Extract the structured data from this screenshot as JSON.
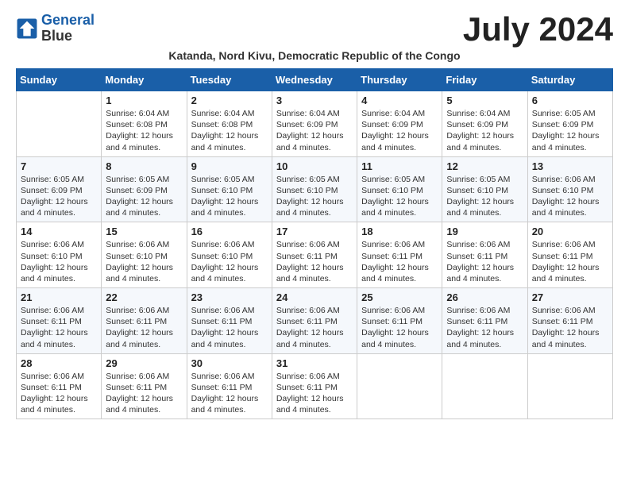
{
  "logo": {
    "line1": "General",
    "line2": "Blue"
  },
  "title": "July 2024",
  "subtitle": "Katanda, Nord Kivu, Democratic Republic of the Congo",
  "weekdays": [
    "Sunday",
    "Monday",
    "Tuesday",
    "Wednesday",
    "Thursday",
    "Friday",
    "Saturday"
  ],
  "weeks": [
    [
      {
        "day": "",
        "sunrise": "",
        "sunset": "",
        "daylight": ""
      },
      {
        "day": "1",
        "sunrise": "Sunrise: 6:04 AM",
        "sunset": "Sunset: 6:08 PM",
        "daylight": "Daylight: 12 hours and 4 minutes."
      },
      {
        "day": "2",
        "sunrise": "Sunrise: 6:04 AM",
        "sunset": "Sunset: 6:08 PM",
        "daylight": "Daylight: 12 hours and 4 minutes."
      },
      {
        "day": "3",
        "sunrise": "Sunrise: 6:04 AM",
        "sunset": "Sunset: 6:09 PM",
        "daylight": "Daylight: 12 hours and 4 minutes."
      },
      {
        "day": "4",
        "sunrise": "Sunrise: 6:04 AM",
        "sunset": "Sunset: 6:09 PM",
        "daylight": "Daylight: 12 hours and 4 minutes."
      },
      {
        "day": "5",
        "sunrise": "Sunrise: 6:04 AM",
        "sunset": "Sunset: 6:09 PM",
        "daylight": "Daylight: 12 hours and 4 minutes."
      },
      {
        "day": "6",
        "sunrise": "Sunrise: 6:05 AM",
        "sunset": "Sunset: 6:09 PM",
        "daylight": "Daylight: 12 hours and 4 minutes."
      }
    ],
    [
      {
        "day": "7",
        "sunrise": "Sunrise: 6:05 AM",
        "sunset": "Sunset: 6:09 PM",
        "daylight": "Daylight: 12 hours and 4 minutes."
      },
      {
        "day": "8",
        "sunrise": "Sunrise: 6:05 AM",
        "sunset": "Sunset: 6:09 PM",
        "daylight": "Daylight: 12 hours and 4 minutes."
      },
      {
        "day": "9",
        "sunrise": "Sunrise: 6:05 AM",
        "sunset": "Sunset: 6:10 PM",
        "daylight": "Daylight: 12 hours and 4 minutes."
      },
      {
        "day": "10",
        "sunrise": "Sunrise: 6:05 AM",
        "sunset": "Sunset: 6:10 PM",
        "daylight": "Daylight: 12 hours and 4 minutes."
      },
      {
        "day": "11",
        "sunrise": "Sunrise: 6:05 AM",
        "sunset": "Sunset: 6:10 PM",
        "daylight": "Daylight: 12 hours and 4 minutes."
      },
      {
        "day": "12",
        "sunrise": "Sunrise: 6:05 AM",
        "sunset": "Sunset: 6:10 PM",
        "daylight": "Daylight: 12 hours and 4 minutes."
      },
      {
        "day": "13",
        "sunrise": "Sunrise: 6:06 AM",
        "sunset": "Sunset: 6:10 PM",
        "daylight": "Daylight: 12 hours and 4 minutes."
      }
    ],
    [
      {
        "day": "14",
        "sunrise": "Sunrise: 6:06 AM",
        "sunset": "Sunset: 6:10 PM",
        "daylight": "Daylight: 12 hours and 4 minutes."
      },
      {
        "day": "15",
        "sunrise": "Sunrise: 6:06 AM",
        "sunset": "Sunset: 6:10 PM",
        "daylight": "Daylight: 12 hours and 4 minutes."
      },
      {
        "day": "16",
        "sunrise": "Sunrise: 6:06 AM",
        "sunset": "Sunset: 6:10 PM",
        "daylight": "Daylight: 12 hours and 4 minutes."
      },
      {
        "day": "17",
        "sunrise": "Sunrise: 6:06 AM",
        "sunset": "Sunset: 6:11 PM",
        "daylight": "Daylight: 12 hours and 4 minutes."
      },
      {
        "day": "18",
        "sunrise": "Sunrise: 6:06 AM",
        "sunset": "Sunset: 6:11 PM",
        "daylight": "Daylight: 12 hours and 4 minutes."
      },
      {
        "day": "19",
        "sunrise": "Sunrise: 6:06 AM",
        "sunset": "Sunset: 6:11 PM",
        "daylight": "Daylight: 12 hours and 4 minutes."
      },
      {
        "day": "20",
        "sunrise": "Sunrise: 6:06 AM",
        "sunset": "Sunset: 6:11 PM",
        "daylight": "Daylight: 12 hours and 4 minutes."
      }
    ],
    [
      {
        "day": "21",
        "sunrise": "Sunrise: 6:06 AM",
        "sunset": "Sunset: 6:11 PM",
        "daylight": "Daylight: 12 hours and 4 minutes."
      },
      {
        "day": "22",
        "sunrise": "Sunrise: 6:06 AM",
        "sunset": "Sunset: 6:11 PM",
        "daylight": "Daylight: 12 hours and 4 minutes."
      },
      {
        "day": "23",
        "sunrise": "Sunrise: 6:06 AM",
        "sunset": "Sunset: 6:11 PM",
        "daylight": "Daylight: 12 hours and 4 minutes."
      },
      {
        "day": "24",
        "sunrise": "Sunrise: 6:06 AM",
        "sunset": "Sunset: 6:11 PM",
        "daylight": "Daylight: 12 hours and 4 minutes."
      },
      {
        "day": "25",
        "sunrise": "Sunrise: 6:06 AM",
        "sunset": "Sunset: 6:11 PM",
        "daylight": "Daylight: 12 hours and 4 minutes."
      },
      {
        "day": "26",
        "sunrise": "Sunrise: 6:06 AM",
        "sunset": "Sunset: 6:11 PM",
        "daylight": "Daylight: 12 hours and 4 minutes."
      },
      {
        "day": "27",
        "sunrise": "Sunrise: 6:06 AM",
        "sunset": "Sunset: 6:11 PM",
        "daylight": "Daylight: 12 hours and 4 minutes."
      }
    ],
    [
      {
        "day": "28",
        "sunrise": "Sunrise: 6:06 AM",
        "sunset": "Sunset: 6:11 PM",
        "daylight": "Daylight: 12 hours and 4 minutes."
      },
      {
        "day": "29",
        "sunrise": "Sunrise: 6:06 AM",
        "sunset": "Sunset: 6:11 PM",
        "daylight": "Daylight: 12 hours and 4 minutes."
      },
      {
        "day": "30",
        "sunrise": "Sunrise: 6:06 AM",
        "sunset": "Sunset: 6:11 PM",
        "daylight": "Daylight: 12 hours and 4 minutes."
      },
      {
        "day": "31",
        "sunrise": "Sunrise: 6:06 AM",
        "sunset": "Sunset: 6:11 PM",
        "daylight": "Daylight: 12 hours and 4 minutes."
      },
      {
        "day": "",
        "sunrise": "",
        "sunset": "",
        "daylight": ""
      },
      {
        "day": "",
        "sunrise": "",
        "sunset": "",
        "daylight": ""
      },
      {
        "day": "",
        "sunrise": "",
        "sunset": "",
        "daylight": ""
      }
    ]
  ]
}
